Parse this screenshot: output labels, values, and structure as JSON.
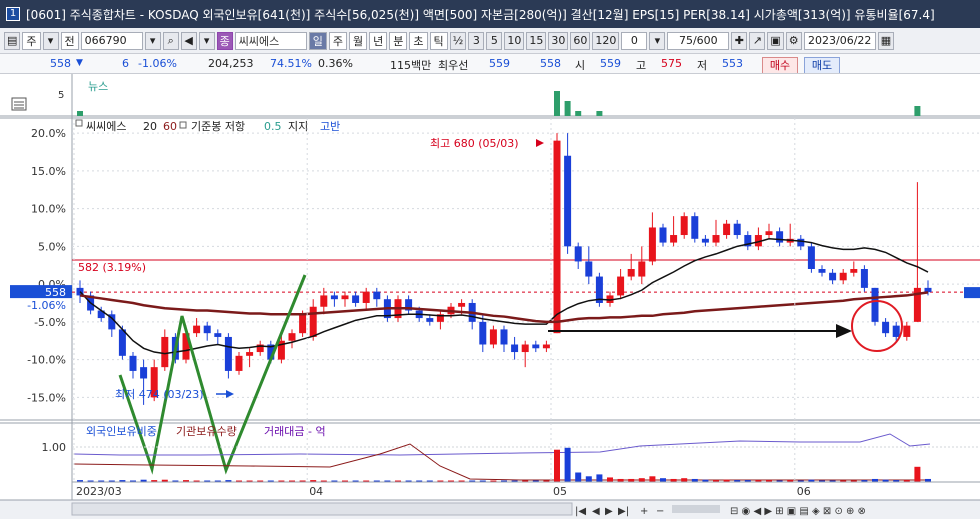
{
  "window": {
    "badge": "1",
    "title": "[0601] 주식종합차트 - KOSDAQ 외국인보유[641(천)] 주식수[56,025(천)] 액면[500] 자본금[280(억)] 결산[12월] EPS[15] PER[38.14] 시가총액[313(억)] 유통비율[67.4]"
  },
  "toolbar": {
    "market": "주",
    "period_type": "전",
    "code": "066790",
    "stock_name": "씨씨에스",
    "timeframes": [
      "일",
      "주",
      "월",
      "년",
      "분",
      "초",
      "틱"
    ],
    "active_timeframe": "일",
    "minutes": [
      "3",
      "5",
      "10",
      "15",
      "30",
      "60",
      "120"
    ],
    "fraction": "½",
    "count_value": "0",
    "page_current": "75",
    "page_total": "/600",
    "date": "2023/06/22"
  },
  "info": {
    "price": "558",
    "change_arrow": "▼",
    "change": "6",
    "change_pct": "-1.06%",
    "volume": "204,253",
    "vol_ratio": "74.51%",
    "turnover": "0.36%",
    "trade_value": "115백만",
    "best_bid_label": "최우선",
    "best_bid": "559",
    "best_ask": "558",
    "open_label": "시",
    "open": "559",
    "high_label": "고",
    "high": "575",
    "low_label": "저",
    "low": "553",
    "buy_label": "매수",
    "sell_label": "매도"
  },
  "panels": {
    "news": {
      "label": "뉴스",
      "axis_tick": "5"
    },
    "price": {
      "legend_name": "씨씨에스",
      "legend_ma1": "20",
      "legend_ma2": "60",
      "legend_ichimoku": "기준봉 저항",
      "legend_support_value": "0.5",
      "legend_support": "지지",
      "legend_high_label": "고반",
      "high_annotation": "최고 680 (05/03)",
      "low_annotation": "최저 474 (03/23)",
      "resistance_label": "582 (3.19%)",
      "current_price_tag": "558",
      "current_pct_tag": "-1.06%"
    },
    "volume": {
      "legend_foreign": "외국인보유비중",
      "legend_inst": "기관보유수량",
      "legend_value": "거래대금 - 억",
      "axis_tick": "1.00"
    }
  },
  "chart_data": {
    "type": "candlestick",
    "ylabel_ticks": [
      "20.0%",
      "15.0%",
      "10.0%",
      "5.0%",
      "0.0%",
      "-5.0%",
      "-10.0%",
      "-15.0%"
    ],
    "y_ticks_pct": [
      20,
      15,
      10,
      5,
      0,
      -5,
      -10,
      -15
    ],
    "ylim_pct": [
      -18,
      22
    ],
    "x_labels": [
      "2023/03",
      "04",
      "05",
      "06"
    ],
    "x_label_index": [
      0,
      22,
      45,
      68
    ],
    "candles": [
      {
        "o": -0.5,
        "c": -1.5,
        "h": 0.5,
        "l": -2.5
      },
      {
        "o": -1.5,
        "c": -3.5,
        "h": -1,
        "l": -4
      },
      {
        "o": -3.5,
        "c": -4.5,
        "h": -3,
        "l": -5
      },
      {
        "o": -4,
        "c": -6,
        "h": -3.5,
        "l": -7
      },
      {
        "o": -6,
        "c": -9.5,
        "h": -5.5,
        "l": -10
      },
      {
        "o": -9.5,
        "c": -11.5,
        "h": -9,
        "l": -12.5
      },
      {
        "o": -11,
        "c": -12.5,
        "h": -10,
        "l": -16
      },
      {
        "o": -15,
        "c": -11,
        "h": -10,
        "l": -15.5
      },
      {
        "o": -11,
        "c": -7,
        "h": -6,
        "l": -11.5
      },
      {
        "o": -7,
        "c": -10,
        "h": -6.5,
        "l": -10.5
      },
      {
        "o": -10,
        "c": -6.5,
        "h": -5.5,
        "l": -10.5
      },
      {
        "o": -6.5,
        "c": -5.5,
        "h": -4.5,
        "l": -7
      },
      {
        "o": -5.5,
        "c": -6.5,
        "h": -5,
        "l": -7.5
      },
      {
        "o": -6.5,
        "c": -7,
        "h": -6,
        "l": -8
      },
      {
        "o": -7,
        "c": -11.5,
        "h": -6.5,
        "l": -12.5
      },
      {
        "o": -11.5,
        "c": -9.5,
        "h": -9,
        "l": -12
      },
      {
        "o": -9.5,
        "c": -9,
        "h": -8.5,
        "l": -11
      },
      {
        "o": -9,
        "c": -8,
        "h": -7.5,
        "l": -9.5
      },
      {
        "o": -8,
        "c": -10,
        "h": -7.5,
        "l": -10.5
      },
      {
        "o": -10,
        "c": -7.5,
        "h": -6.5,
        "l": -10.5
      },
      {
        "o": -7.5,
        "c": -6.5,
        "h": -6,
        "l": -8.5
      },
      {
        "o": -6.5,
        "c": -4,
        "h": -3.5,
        "l": -7
      },
      {
        "o": -7,
        "c": -3,
        "h": -2,
        "l": -7.5
      },
      {
        "o": -3,
        "c": -1.5,
        "h": -0.5,
        "l": -4
      },
      {
        "o": -1.5,
        "c": -2,
        "h": -1,
        "l": -3
      },
      {
        "o": -2,
        "c": -1.5,
        "h": -1,
        "l": -3
      },
      {
        "o": -1.5,
        "c": -2.5,
        "h": -1,
        "l": -3
      },
      {
        "o": -2.5,
        "c": -1,
        "h": -0.5,
        "l": -3.5
      },
      {
        "o": -1,
        "c": -2,
        "h": -0.5,
        "l": -3
      },
      {
        "o": -2,
        "c": -4.5,
        "h": -1.5,
        "l": -5
      },
      {
        "o": -4.5,
        "c": -2,
        "h": -1.5,
        "l": -5
      },
      {
        "o": -2,
        "c": -3.5,
        "h": -1.5,
        "l": -4
      },
      {
        "o": -3.5,
        "c": -4.5,
        "h": -3,
        "l": -5
      },
      {
        "o": -4.5,
        "c": -5,
        "h": -4,
        "l": -5.5
      },
      {
        "o": -5,
        "c": -4,
        "h": -3.5,
        "l": -6
      },
      {
        "o": -4,
        "c": -3,
        "h": -2.5,
        "l": -4.5
      },
      {
        "o": -3,
        "c": -2.5,
        "h": -2,
        "l": -4
      },
      {
        "o": -2.5,
        "c": -5,
        "h": -2,
        "l": -6
      },
      {
        "o": -5,
        "c": -8,
        "h": -4,
        "l": -9
      },
      {
        "o": -8,
        "c": -6,
        "h": -5.5,
        "l": -8.5
      },
      {
        "o": -6,
        "c": -8,
        "h": -5.5,
        "l": -9
      },
      {
        "o": -8,
        "c": -9,
        "h": -7,
        "l": -10
      },
      {
        "o": -9,
        "c": -8,
        "h": -7.5,
        "l": -11
      },
      {
        "o": -8,
        "c": -8.5,
        "h": -7.5,
        "l": -9
      },
      {
        "o": -8.5,
        "c": -8,
        "h": -7.5,
        "l": -9
      },
      {
        "o": -6.5,
        "c": 19,
        "h": 20,
        "l": -6.5
      },
      {
        "o": 17,
        "c": 5,
        "h": 20,
        "l": 4
      },
      {
        "o": 5,
        "c": 3,
        "h": 5.5,
        "l": 2
      },
      {
        "o": 3,
        "c": 1,
        "h": 5,
        "l": 0
      },
      {
        "o": 1,
        "c": -2.5,
        "h": 1.5,
        "l": -3
      },
      {
        "o": -2.5,
        "c": -1.5,
        "h": -1,
        "l": -3
      },
      {
        "o": -1.5,
        "c": 1,
        "h": 2,
        "l": -2
      },
      {
        "o": 1,
        "c": 2,
        "h": 4,
        "l": 0.5
      },
      {
        "o": 1,
        "c": 3,
        "h": 5,
        "l": 0
      },
      {
        "o": 3,
        "c": 7.5,
        "h": 9.5,
        "l": 2.5
      },
      {
        "o": 7.5,
        "c": 5.5,
        "h": 8,
        "l": 5
      },
      {
        "o": 5.5,
        "c": 6.5,
        "h": 9,
        "l": 5
      },
      {
        "o": 6.5,
        "c": 9,
        "h": 9.5,
        "l": 6
      },
      {
        "o": 9,
        "c": 6,
        "h": 9.5,
        "l": 5.5
      },
      {
        "o": 6,
        "c": 5.5,
        "h": 6.5,
        "l": 5
      },
      {
        "o": 5.5,
        "c": 6.5,
        "h": 8.5,
        "l": 5
      },
      {
        "o": 6.5,
        "c": 8,
        "h": 8.5,
        "l": 6
      },
      {
        "o": 8,
        "c": 6.5,
        "h": 8.5,
        "l": 6
      },
      {
        "o": 6.5,
        "c": 5,
        "h": 7,
        "l": 4.5
      },
      {
        "o": 5,
        "c": 6.5,
        "h": 7.5,
        "l": 4.5
      },
      {
        "o": 6.5,
        "c": 7,
        "h": 8,
        "l": 6
      },
      {
        "o": 7,
        "c": 5.5,
        "h": 7.5,
        "l": 5
      },
      {
        "o": 5.5,
        "c": 6,
        "h": 8,
        "l": 5
      },
      {
        "o": 6,
        "c": 5,
        "h": 6.5,
        "l": 4.5
      },
      {
        "o": 5,
        "c": 2,
        "h": 5.5,
        "l": 1.5
      },
      {
        "o": 2,
        "c": 1.5,
        "h": 2.5,
        "l": 1
      },
      {
        "o": 1.5,
        "c": 0.5,
        "h": 2,
        "l": 0
      },
      {
        "o": 0.5,
        "c": 1.5,
        "h": 2,
        "l": 0
      },
      {
        "o": 1.5,
        "c": 2,
        "h": 3,
        "l": 1
      },
      {
        "o": 2,
        "c": -0.5,
        "h": 2.5,
        "l": -1
      },
      {
        "o": -0.5,
        "c": -5,
        "h": -0.5,
        "l": -5.5
      },
      {
        "o": -5,
        "c": -6.5,
        "h": -4.5,
        "l": -7
      },
      {
        "o": -5.5,
        "c": -7,
        "h": -5,
        "l": -7.5
      },
      {
        "o": -7,
        "c": -5.5,
        "h": -5,
        "l": -7.5
      },
      {
        "o": -5,
        "c": -0.5,
        "h": 13.5,
        "l": -5
      },
      {
        "o": -0.5,
        "c": -1.06,
        "h": 0.5,
        "l": -1.5
      }
    ],
    "ma_short": [
      -1.0,
      -2.5,
      -3.5,
      -4.5,
      -6,
      -7.5,
      -8.5,
      -9,
      -9.2,
      -9,
      -8.8,
      -8.5,
      -8.2,
      -8,
      -8.3,
      -8.5,
      -8.4,
      -8.2,
      -8.3,
      -8,
      -7.7,
      -7.3,
      -6.9,
      -6.3,
      -5.8,
      -5.3,
      -4.8,
      -4.5,
      -4.2,
      -4.2,
      -4.1,
      -4,
      -4,
      -4.1,
      -4.2,
      -4.2,
      -4.1,
      -4.3,
      -4.6,
      -4.8,
      -5,
      -5.2,
      -5.3,
      -5.3,
      -5.3,
      -4.0,
      -3.2,
      -2.6,
      -2.2,
      -2.0,
      -2.1,
      -1.9,
      -1.4,
      -0.8,
      0.2,
      0.9,
      1.6,
      2.4,
      3.1,
      3.6,
      4.0,
      4.5,
      5.0,
      5.3,
      5.6,
      6.0,
      5.9,
      5.8,
      5.7,
      5.5,
      5.1,
      4.8,
      4.6,
      4.6,
      4.8,
      4.6,
      4.2,
      3.5,
      2.8,
      2.3,
      1.6
    ],
    "ma_long": [
      -1.5,
      -1.7,
      -1.9,
      -2.1,
      -2.3,
      -2.5,
      -2.8,
      -3.0,
      -3.2,
      -3.3,
      -3.4,
      -3.5,
      -3.5,
      -3.6,
      -3.7,
      -3.8,
      -3.9,
      -3.9,
      -4.0,
      -4.0,
      -4.0,
      -4.0,
      -3.9,
      -3.8,
      -3.7,
      -3.6,
      -3.5,
      -3.4,
      -3.3,
      -3.2,
      -3.2,
      -3.2,
      -3.3,
      -3.4,
      -3.5,
      -3.6,
      -3.7,
      -3.8,
      -4.0,
      -4.2,
      -4.3,
      -4.5,
      -4.7,
      -4.9,
      -5.0,
      -5.0,
      -4.8,
      -4.6,
      -4.5,
      -4.5,
      -4.4,
      -4.4,
      -4.3,
      -4.2,
      -4.2,
      -4.0,
      -3.9,
      -3.8,
      -3.6,
      -3.5,
      -3.4,
      -3.3,
      -3.2,
      -3.1,
      -3.0,
      -2.9,
      -2.8,
      -2.7,
      -2.6,
      -2.5,
      -2.4,
      -2.3,
      -2.2,
      -2.0,
      -1.9,
      -1.8,
      -1.7,
      -1.6,
      -1.5,
      -1.3,
      -1.1
    ],
    "resistance_pct": 3.19,
    "current_pct": -1.06,
    "news_counts": [
      1,
      0,
      0,
      0,
      0,
      0,
      0,
      0,
      0,
      0,
      0,
      0,
      0,
      0,
      0,
      0,
      0,
      0,
      0,
      0,
      0,
      0,
      0,
      0,
      0,
      0,
      0,
      0,
      0,
      0,
      0,
      0,
      0,
      0,
      0,
      0,
      0,
      0,
      0,
      0,
      0,
      0,
      0,
      0,
      0,
      5,
      3,
      1,
      0,
      1,
      0,
      0,
      0,
      0,
      0,
      0,
      0,
      0,
      0,
      0,
      0,
      0,
      0,
      0,
      0,
      0,
      0,
      0,
      0,
      0,
      0,
      0,
      0,
      0,
      0,
      0,
      0,
      0,
      0,
      2,
      0
    ],
    "value_bars": [
      0.05,
      0.04,
      0.03,
      0.03,
      0.05,
      0.04,
      0.06,
      0.05,
      0.06,
      0.04,
      0.05,
      0.03,
      0.03,
      0.02,
      0.05,
      0.03,
      0.03,
      0.02,
      0.03,
      0.03,
      0.02,
      0.04,
      0.05,
      0.03,
      0.02,
      0.02,
      0.02,
      0.03,
      0.02,
      0.03,
      0.03,
      0.02,
      0.02,
      0.02,
      0.03,
      0.02,
      0.02,
      0.03,
      0.03,
      0.02,
      0.02,
      0.02,
      0.02,
      0.01,
      0.01,
      0.85,
      0.9,
      0.25,
      0.15,
      0.2,
      0.12,
      0.08,
      0.08,
      0.1,
      0.15,
      0.1,
      0.08,
      0.1,
      0.08,
      0.06,
      0.05,
      0.06,
      0.05,
      0.05,
      0.05,
      0.05,
      0.04,
      0.05,
      0.04,
      0.06,
      0.04,
      0.03,
      0.03,
      0.03,
      0.05,
      0.08,
      0.06,
      0.05,
      0.05,
      0.4,
      0.08
    ]
  }
}
